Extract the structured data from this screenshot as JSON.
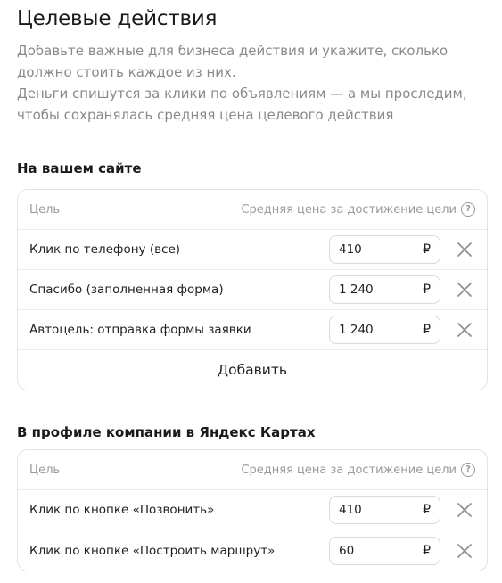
{
  "page": {
    "title": "Целевые действия",
    "description_line1": "Добавьте важные для бизнеса действия и укажите, сколько должно стоить каждое из них.",
    "description_line2": "Деньги спишутся за клики по объявлениям — а мы проследим, чтобы сохранялась средняя цена целевого действия"
  },
  "site_section": {
    "title": "На вашем сайте",
    "header_goal": "Цель",
    "header_price": "Средняя цена за достижение цели",
    "help_icon": "question-circle-icon",
    "rows": [
      {
        "name": "Клик по телефону (все)",
        "price": "410",
        "currency": "₽"
      },
      {
        "name": "Спасибо (заполненная форма)",
        "price": "1 240",
        "currency": "₽"
      },
      {
        "name": "Автоцель: отправка формы заявки",
        "price": "1 240",
        "currency": "₽"
      }
    ],
    "add_label": "Добавить"
  },
  "maps_section": {
    "title": "В профиле компании в Яндекс Картах",
    "header_goal": "Цель",
    "header_price": "Средняя цена за достижение цели",
    "rows": [
      {
        "name": "Клик по кнопке «Позвонить»",
        "price": "410",
        "currency": "₽"
      },
      {
        "name": "Клик по кнопке «Построить маршрут»",
        "price": "60",
        "currency": "₽"
      }
    ]
  },
  "colors": {
    "text_primary": "#1f1f1f",
    "text_muted": "#8a8a8a",
    "border": "#e3e3e3",
    "close_icon": "#8f8f8f"
  }
}
